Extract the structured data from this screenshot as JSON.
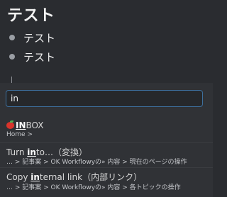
{
  "page": {
    "title": "テスト",
    "bullets": [
      "テスト",
      "テスト"
    ]
  },
  "search": {
    "value": "in"
  },
  "results": [
    {
      "title_pre": "",
      "title_match": "IN",
      "title_post": "BOX",
      "icon": "apple-icon",
      "path": "Home  >"
    },
    {
      "title_pre": "Turn ",
      "title_match": "in",
      "title_post": "to…（変換）",
      "path": "…  >  記事案  >  OK Workflowyの»  内容  >  現在のページの操作"
    },
    {
      "title_pre": "Copy ",
      "title_match": "in",
      "title_post": "ternal link（内部リンク）",
      "path": "…  >  記事案  >  OK Workflowyの»  内容  >  各トピックの操作"
    }
  ],
  "colors": {
    "background": "#2a2c30",
    "popup": "#303236",
    "search_border": "#3d6f9d",
    "apple": "#d8342b"
  }
}
